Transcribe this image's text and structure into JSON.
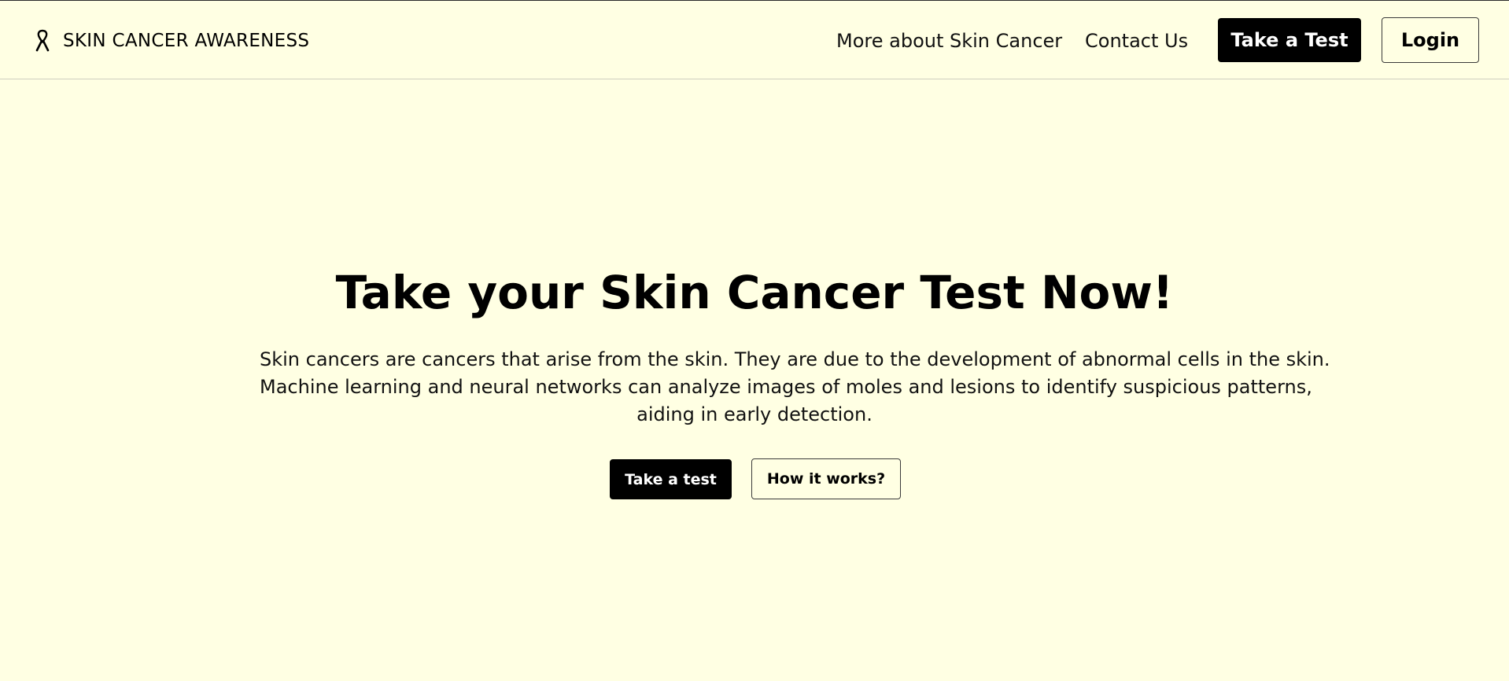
{
  "navbar": {
    "brand": {
      "icon": "awareness-ribbon-icon",
      "title": "SKIN CANCER AWARENESS"
    },
    "links": {
      "more": "More about Skin Cancer",
      "contact": "Contact Us"
    },
    "buttons": {
      "take_test": "Take a Test",
      "login": "Login"
    }
  },
  "hero": {
    "title": "Take your Skin Cancer Test Now!",
    "description_lines": [
      "Skin cancers are cancers that arise from the skin. They are due to the development of abnormal cells in the skin.",
      "Machine learning and neural networks can analyze images of moles and lesions to identify suspicious patterns,",
      "aiding in early detection."
    ],
    "buttons": {
      "take_test": "Take a test",
      "how_it_works": "How it works?"
    }
  },
  "colors": {
    "background": "#ffffe3",
    "primary": "#000000",
    "primary_text": "#ffffff"
  }
}
